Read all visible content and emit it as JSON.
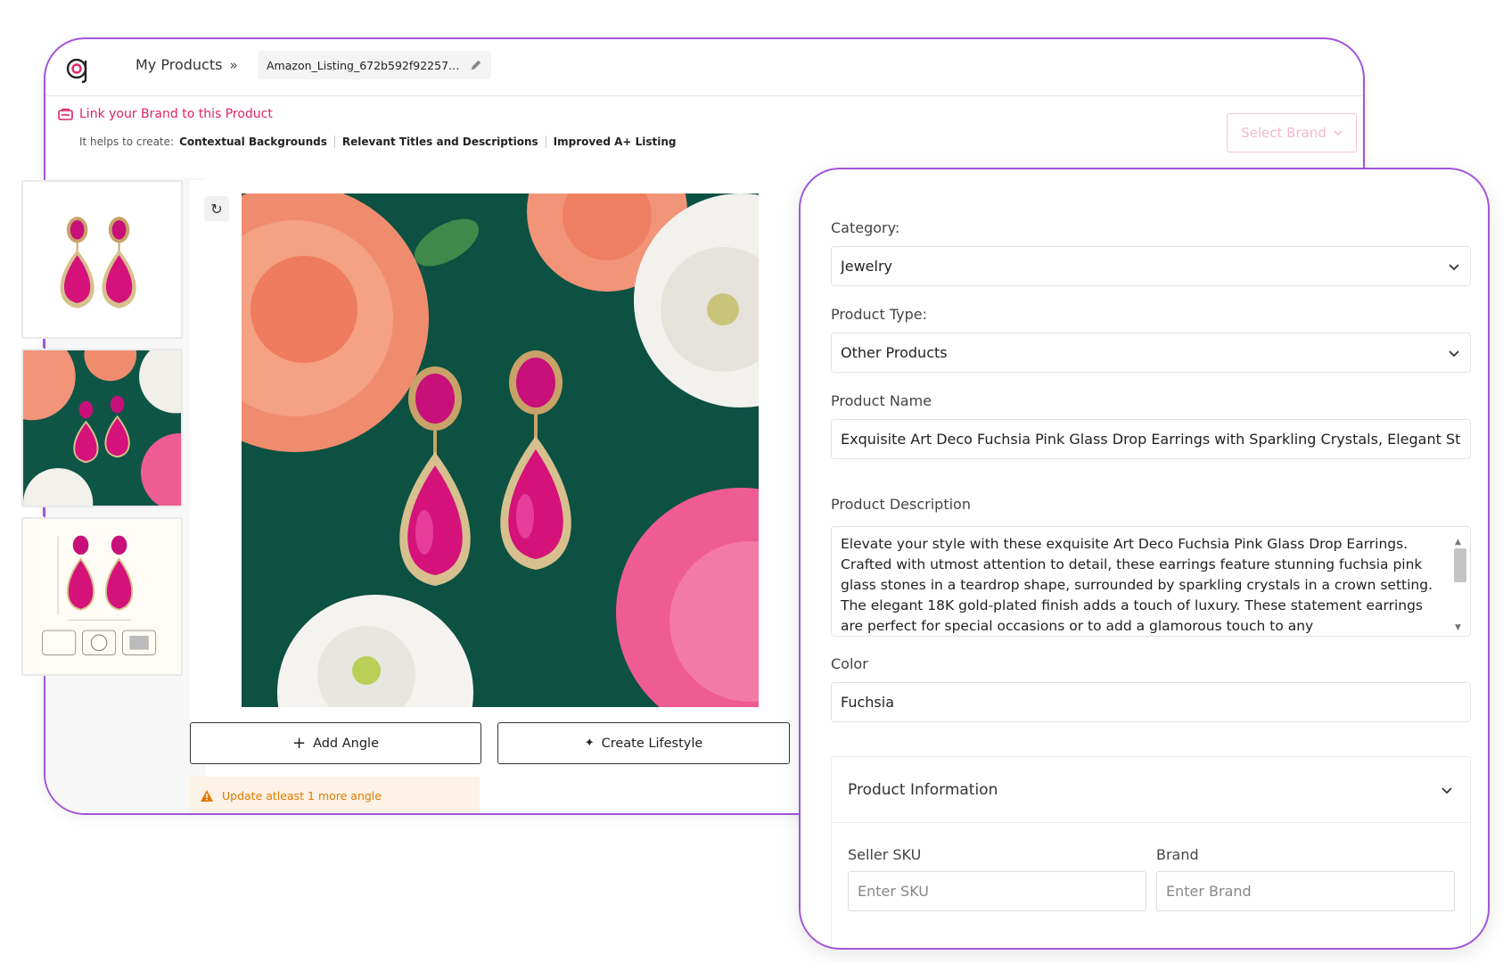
{
  "header": {
    "breadcrumb": "My Products",
    "breadcrumb_sep": "»",
    "listing_name": "Amazon_Listing_672b592f92257a2..."
  },
  "brand_banner": {
    "link_text": "Link your Brand to this Product",
    "helps_prefix": "It helps to create:",
    "benefits": [
      "Contextual Backgrounds",
      "Relevant Titles and Descriptions",
      "Improved A+ Listing"
    ],
    "select_brand": "Select Brand"
  },
  "actions": {
    "add_angle": "Add Angle",
    "create_lifestyle": "Create Lifestyle",
    "warning": "Update atleast 1 more angle"
  },
  "form": {
    "category_label": "Category:",
    "category_value": "Jewelry",
    "product_type_label": "Product Type:",
    "product_type_value": "Other Products",
    "product_name_label": "Product Name",
    "product_name_value": "Exquisite Art Deco Fuchsia Pink Glass Drop Earrings with Sparkling Crystals, Elegant St",
    "description_label": "Product Description",
    "description_value": "Elevate your style with these exquisite Art Deco Fuchsia Pink Glass Drop Earrings. Crafted with utmost attention to detail, these earrings feature stunning fuchsia pink glass stones in a teardrop shape, surrounded by sparkling crystals in a crown setting. The elegant 18K gold-plated finish adds a touch of luxury. These statement earrings are perfect for special occasions or to add a glamorous touch to any",
    "color_label": "Color",
    "color_value": "Fuchsia",
    "info_section_title": "Product Information",
    "seller_sku_label": "Seller SKU",
    "seller_sku_placeholder": "Enter SKU",
    "brand_label": "Brand",
    "brand_placeholder": "Enter Brand"
  },
  "colors": {
    "accent_purple": "#a255d9",
    "brand_pink": "#e0245e",
    "warning_orange": "#e07a00",
    "gem_fuchsia": "#d4127a"
  }
}
